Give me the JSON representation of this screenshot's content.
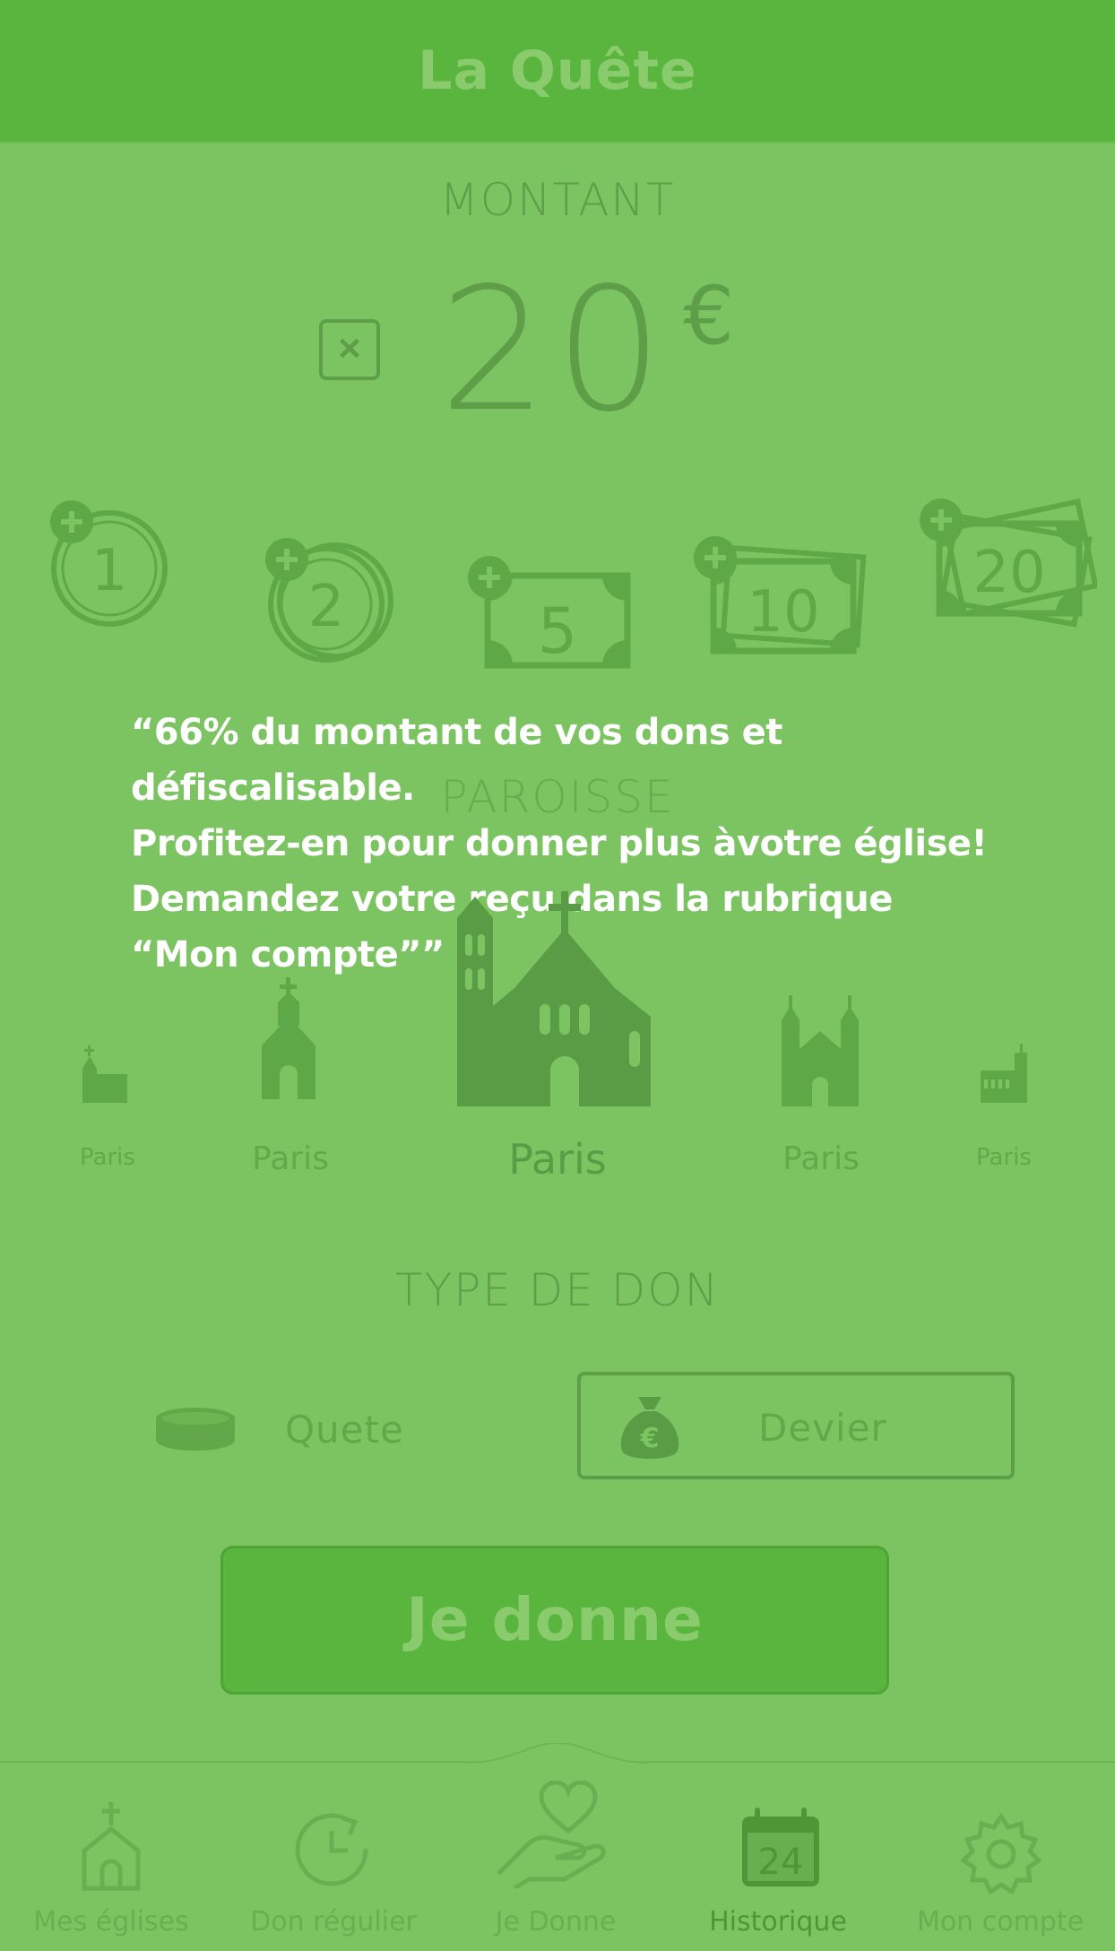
{
  "header": {
    "title": "La Quête"
  },
  "montant": {
    "section_title": "MONTANT",
    "value": "20",
    "currency": "€",
    "quick_amounts": [
      "1",
      "2",
      "5",
      "10",
      "20"
    ]
  },
  "note": {
    "lines": [
      "“66% du montant de vos dons et défiscalisable.",
      "Profitez-en pour donner plus àvotre église!",
      "Demandez votre reçu dans la rubrique",
      "“Mon compte””"
    ]
  },
  "paroisse": {
    "section_title": "PAROISSE",
    "churches": [
      {
        "label": "Paris"
      },
      {
        "label": "Paris"
      },
      {
        "label": "Paris"
      },
      {
        "label": "Paris"
      },
      {
        "label": "Paris"
      }
    ]
  },
  "type_de_don": {
    "section_title": "TYPE DE DON",
    "options": [
      {
        "label": "Quete",
        "selected": false
      },
      {
        "label": "Devier",
        "selected": true
      }
    ]
  },
  "give_button": {
    "label": "Je donne"
  },
  "tabbar": {
    "tabs": [
      {
        "label": "Mes églises",
        "icon": "church-icon",
        "active": false
      },
      {
        "label": "Don régulier",
        "icon": "recurring-clock-icon",
        "active": false
      },
      {
        "label": "Je Donne",
        "icon": "heart-hand-icon",
        "active": false
      },
      {
        "label": "Historique",
        "icon": "calendar-icon",
        "active": true,
        "badge": "24"
      },
      {
        "label": "Mon compte",
        "icon": "gear-icon",
        "active": false
      }
    ]
  },
  "colors": {
    "background": "#7cc462",
    "header": "#5ab53e",
    "dim_text": "#5e9e48",
    "note_text": "#ffffff"
  }
}
